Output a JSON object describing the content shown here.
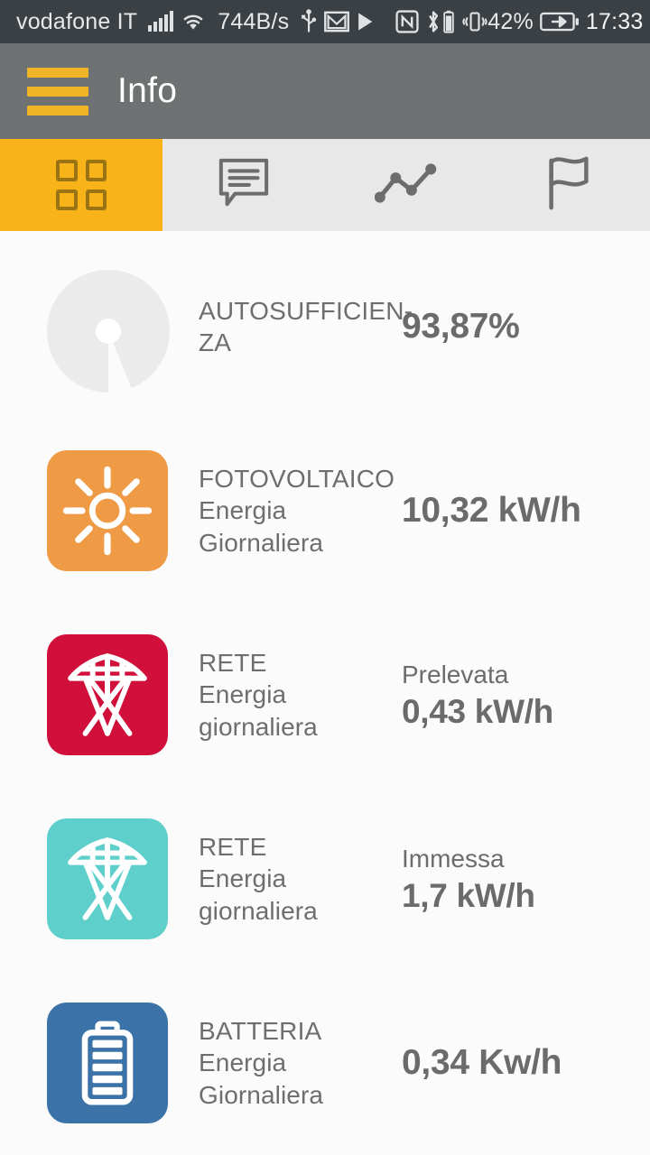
{
  "statusbar": {
    "carrier": "vodafone IT",
    "network_speed": "744B/s",
    "battery_percent": "42%",
    "time": "17:33",
    "icons": [
      "signal-icon",
      "wifi-icon",
      "usb-icon",
      "gmail-icon",
      "play-icon",
      "nfc-icon",
      "bluetooth-icon",
      "battery-small-icon",
      "vibrate-icon",
      "battery-charging-icon"
    ]
  },
  "appbar": {
    "menu_icon": "hamburger-menu-icon",
    "title": "Info",
    "menu_color": "#f0b429",
    "background": "#6e7272"
  },
  "tabs": [
    {
      "icon": "grid-dashboard-icon",
      "active": true,
      "label": ""
    },
    {
      "icon": "message-bubble-icon",
      "active": false,
      "label": ""
    },
    {
      "icon": "line-chart-icon",
      "active": false,
      "label": ""
    },
    {
      "icon": "flag-icon",
      "active": false,
      "label": ""
    }
  ],
  "accent_color": "#f7b318",
  "rows": [
    {
      "icon": "donut-chart-icon",
      "icon_color": "#ebebeb",
      "title": "AUTOSUFFICIEN-",
      "title2": "ZA",
      "subtitle": "",
      "value_label": "",
      "value": "93,87%",
      "percent": 93.87
    },
    {
      "icon": "sun-icon",
      "icon_color": "#ef9a44",
      "title": "FOTOVOLTAICO",
      "title2": "",
      "subtitle": "Energia Giornaliera",
      "value_label": "",
      "value": "10,32 kW/h"
    },
    {
      "icon": "power-pylon-icon",
      "icon_color": "#d0103a",
      "title": "RETE",
      "title2": "",
      "subtitle": "Energia giornaliera",
      "value_label": "Prelevata",
      "value": "0,43 kW/h"
    },
    {
      "icon": "power-pylon-icon",
      "icon_color": "#5ecfcb",
      "title": "RETE",
      "title2": "",
      "subtitle": "Energia giornaliera",
      "value_label": "Immessa",
      "value": "1,7 kW/h"
    },
    {
      "icon": "battery-icon",
      "icon_color": "#3b72a8",
      "title": "BATTERIA",
      "title2": "",
      "subtitle": "Energia Giornaliera",
      "value_label": "",
      "value": "0,34 Kw/h"
    }
  ]
}
